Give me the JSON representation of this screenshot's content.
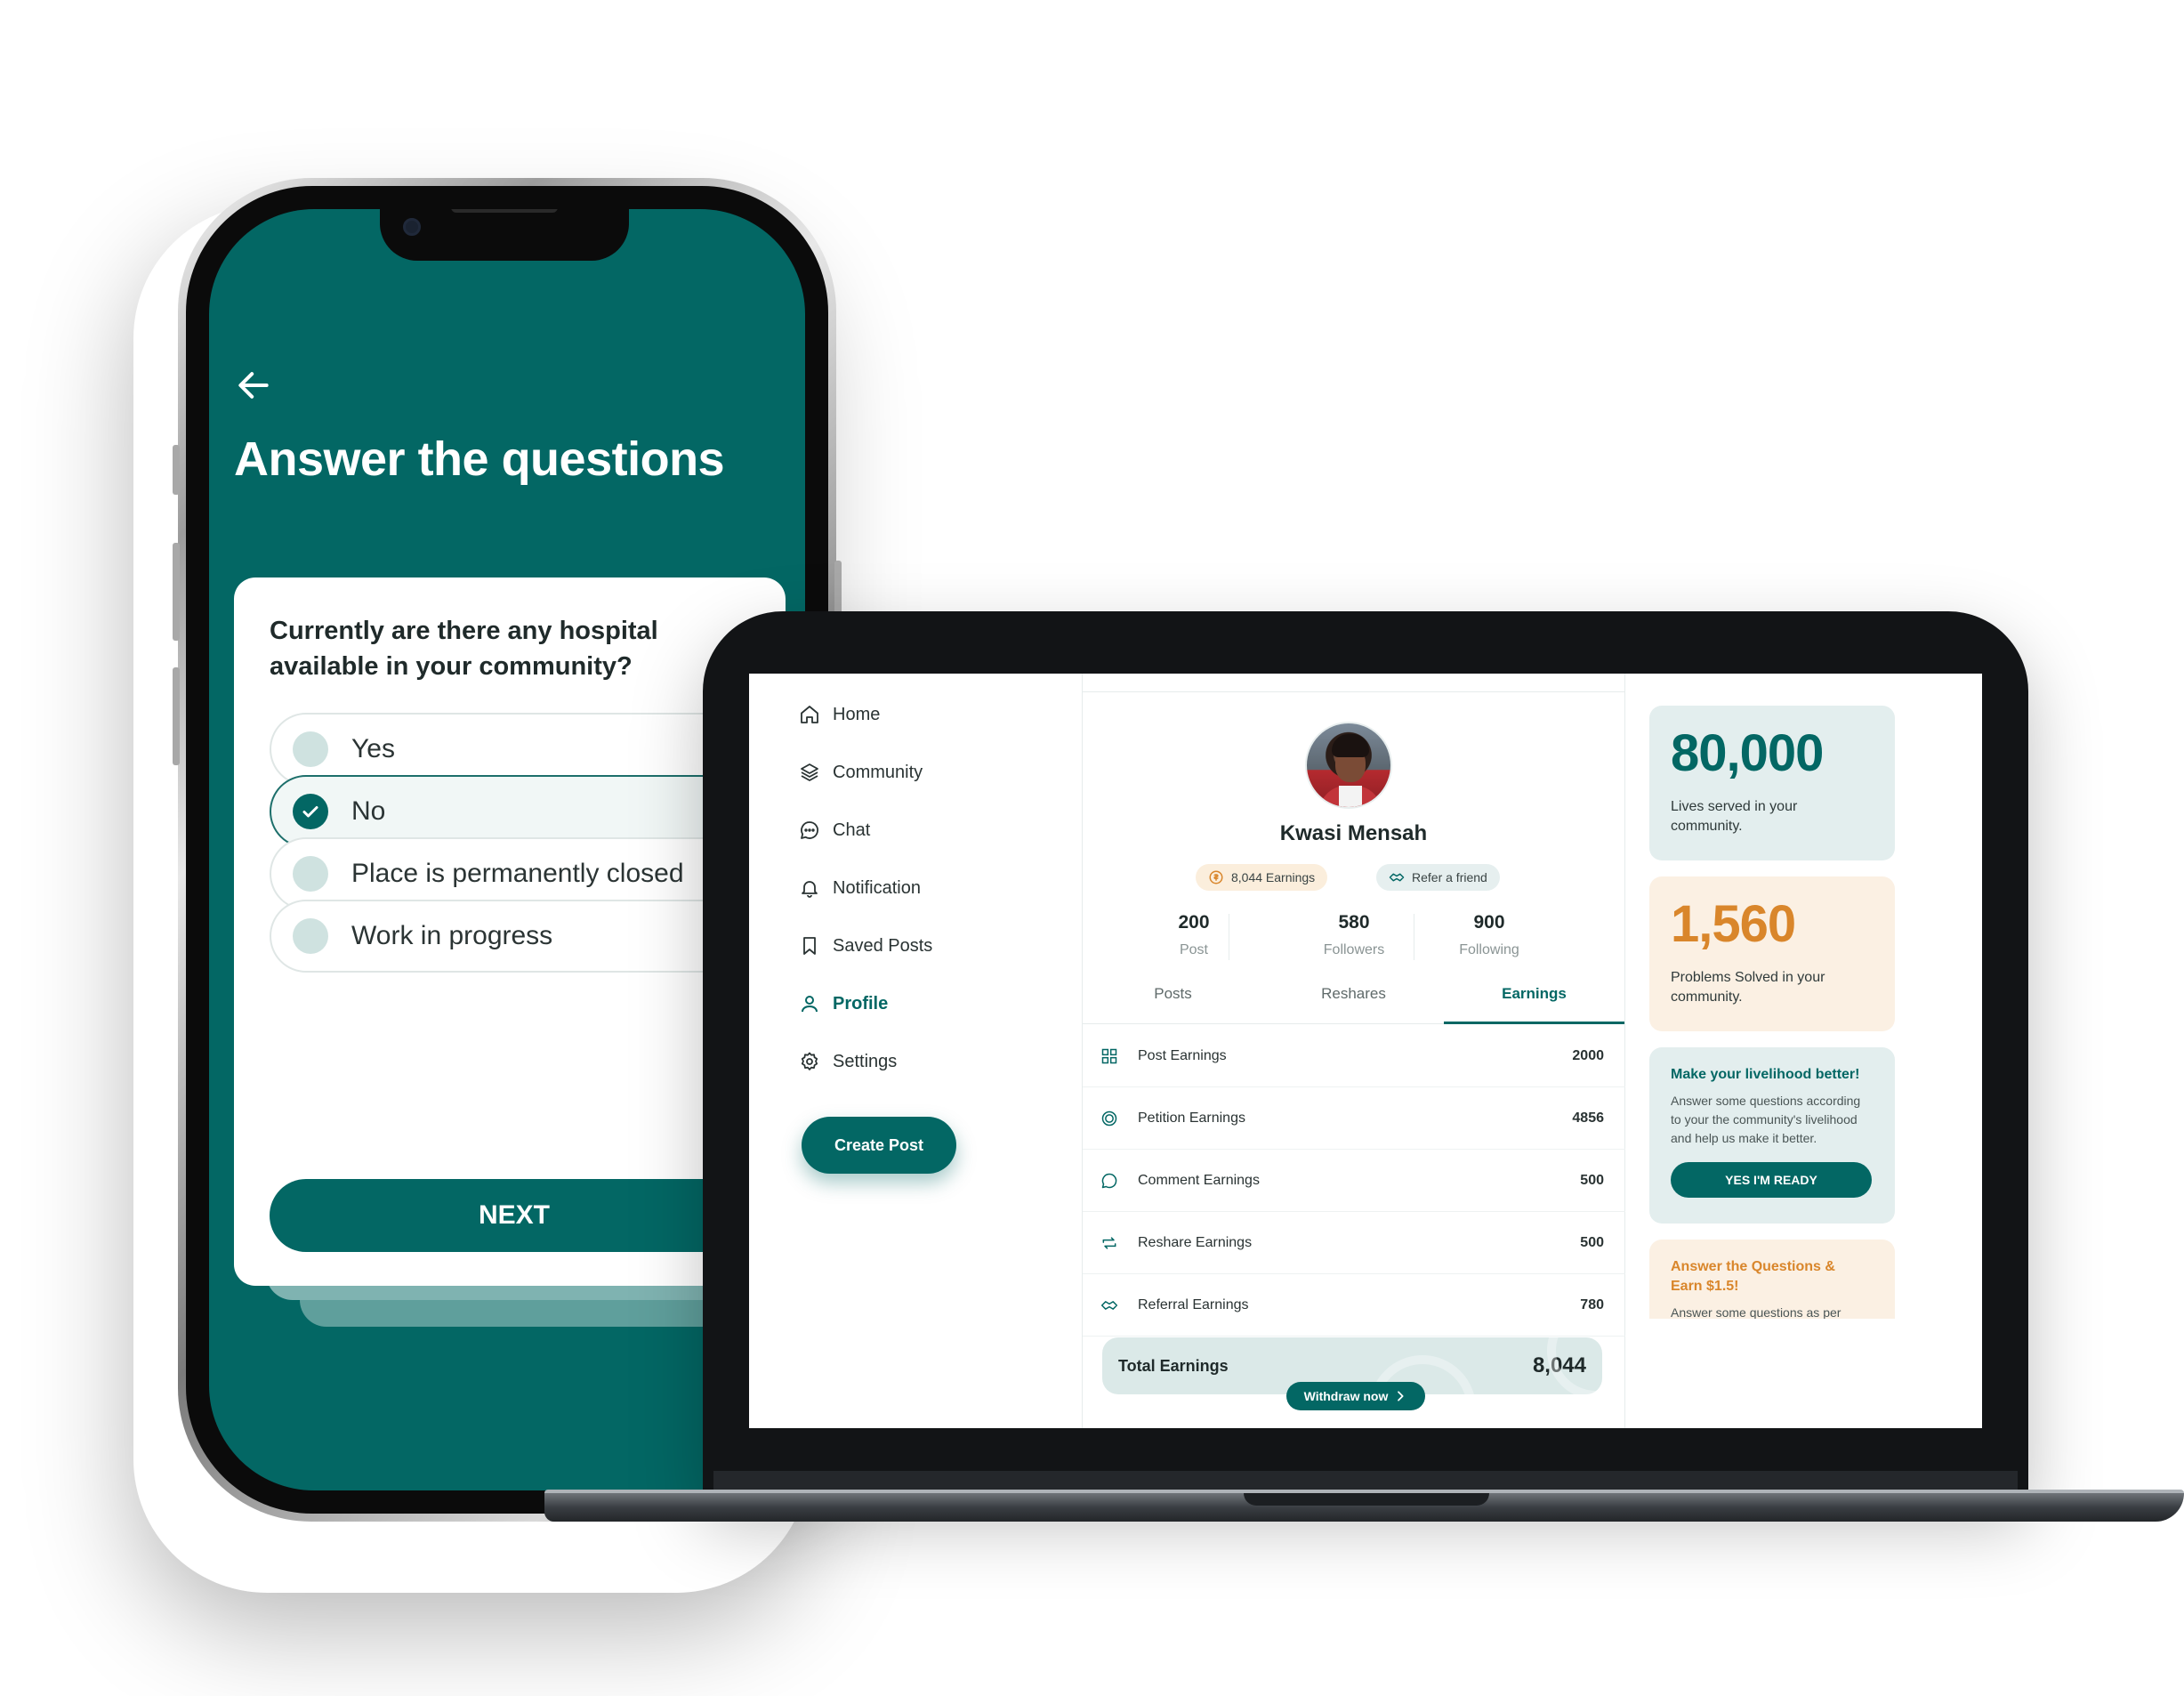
{
  "colors": {
    "primary": "#036764",
    "accent_orange": "#D9862B",
    "teal_light": "#E3EEEE",
    "peach_light": "#FBF0E3"
  },
  "phone": {
    "back_icon": "arrow-left-icon",
    "title": "Answer the questions",
    "question": "Currently are there any hospital available in your community?",
    "options": [
      {
        "label": "Yes",
        "selected": false
      },
      {
        "label": "No",
        "selected": true
      },
      {
        "label": "Place is permanently closed",
        "selected": false
      },
      {
        "label": "Work in progress",
        "selected": false
      }
    ],
    "next_label": "NEXT"
  },
  "laptop": {
    "nav": [
      {
        "label": "Home",
        "icon": "home-icon"
      },
      {
        "label": "Community",
        "icon": "layers-icon"
      },
      {
        "label": "Chat",
        "icon": "chat-icon"
      },
      {
        "label": "Notification",
        "icon": "bell-icon"
      },
      {
        "label": "Saved Posts",
        "icon": "bookmark-icon"
      },
      {
        "label": "Profile",
        "icon": "user-icon",
        "active": true
      },
      {
        "label": "Settings",
        "icon": "gear-icon"
      }
    ],
    "create_post": "Create Post",
    "profile": {
      "name": "Kwasi Mensah",
      "earnings_badge": "8,044 Earnings",
      "refer_badge": "Refer a friend",
      "stats": [
        {
          "value": "200",
          "label": "Post"
        },
        {
          "value": "580",
          "label": "Followers"
        },
        {
          "value": "900",
          "label": "Following"
        }
      ],
      "tabs": [
        "Posts",
        "Reshares",
        "Earnings"
      ],
      "active_tab": "Earnings",
      "earnings": [
        {
          "label": "Post Earnings",
          "value": "2000",
          "icon": "grid-icon"
        },
        {
          "label": "Petition Earnings",
          "value": "4856",
          "icon": "target-icon"
        },
        {
          "label": "Comment Earnings",
          "value": "500",
          "icon": "comment-icon"
        },
        {
          "label": "Reshare Earnings",
          "value": "500",
          "icon": "repeat-icon"
        },
        {
          "label": "Referral Earnings",
          "value": "780",
          "icon": "handshake-icon"
        }
      ],
      "total_label": "Total Earnings",
      "total_value": "8,044",
      "withdraw_label": "Withdraw now"
    },
    "right": {
      "lives": {
        "value": "80,000",
        "desc": "Lives served in your community."
      },
      "problems": {
        "value": "1,560",
        "desc": "Problems Solved in your community."
      },
      "promo1": {
        "title": "Make your livelihood better!",
        "text": "Answer some questions according to your the community's livelihood and help us make it better.",
        "button": "YES I'M READY"
      },
      "promo2": {
        "title": "Answer the Questions & Earn $1.5!",
        "text": "Answer some questions as per"
      }
    }
  }
}
